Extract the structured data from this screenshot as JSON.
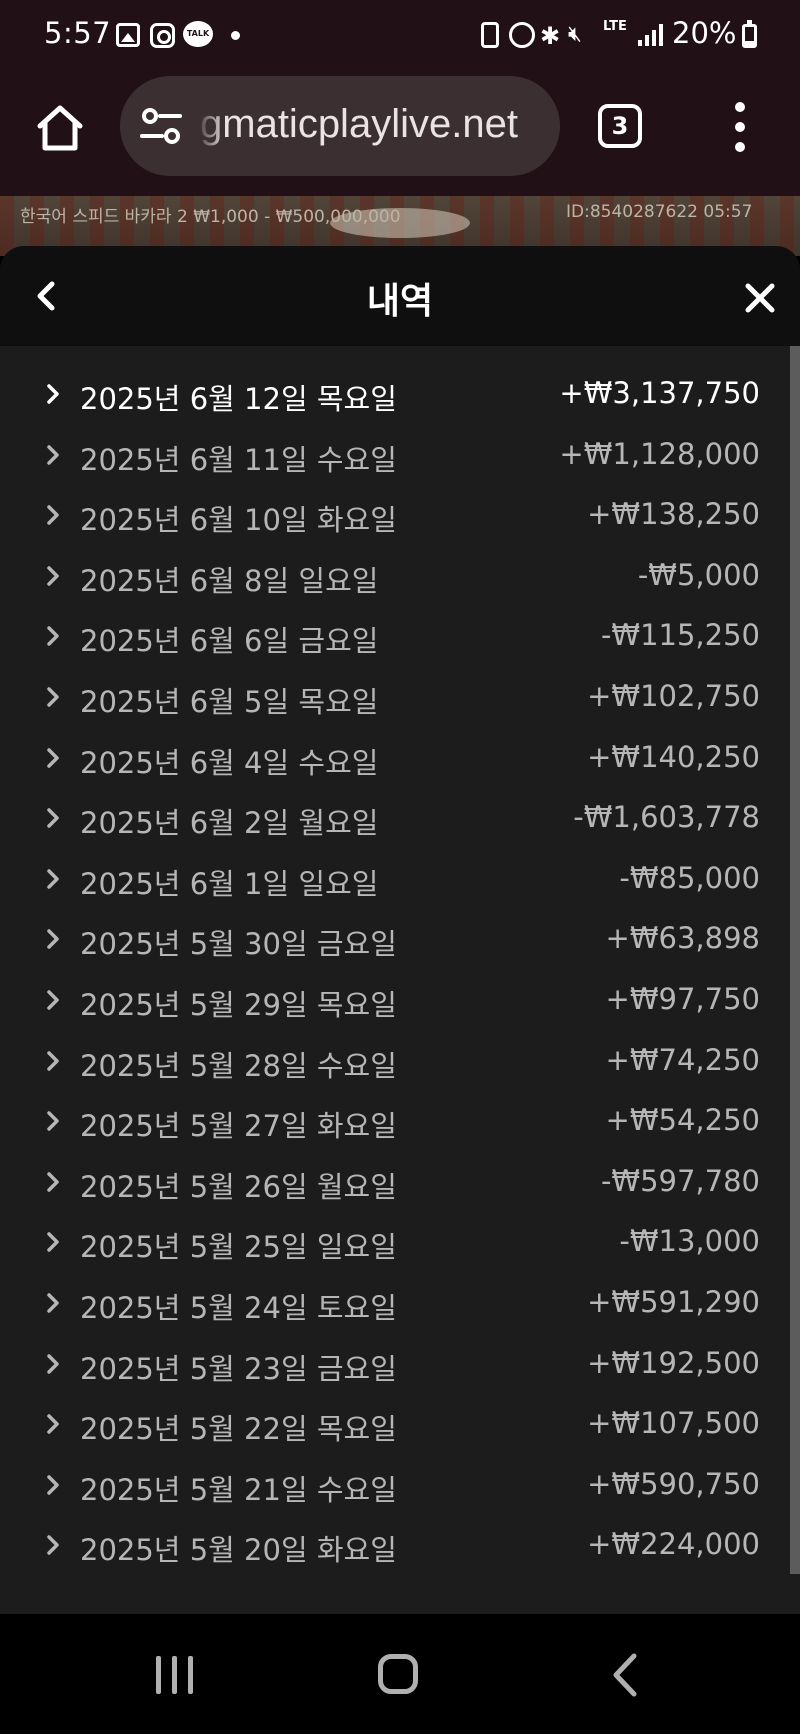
{
  "status_bar": {
    "time": "5:57",
    "notification_icons": [
      "gallery-icon",
      "instagram-icon",
      "kakaotalk-icon",
      "dot-icon"
    ],
    "kakaotalk_label": "TALK",
    "system_icons": [
      "battery-saver-icon",
      "alarm-icon",
      "bluetooth-icon",
      "mute-icon",
      "lte-icon",
      "signal-icon"
    ],
    "lte_label": "LTE",
    "battery_percent": "20%"
  },
  "browser": {
    "url": "gmaticplaylive.net",
    "tab_count": "3",
    "icons": [
      "home-icon",
      "site-settings-icon",
      "tabs-icon",
      "more-menu-icon"
    ]
  },
  "game": {
    "table_info": "한국어 스피드 바카라 2   ₩1,000 - ₩500,000,000",
    "id_info": "ID:8540287622   05:57"
  },
  "history": {
    "title": "내역",
    "rows": [
      {
        "date": "2025년 6월 12일 목요일",
        "amount": "+₩3,137,750"
      },
      {
        "date": "2025년 6월 11일 수요일",
        "amount": "+₩1,128,000"
      },
      {
        "date": "2025년 6월 10일 화요일",
        "amount": "+₩138,250"
      },
      {
        "date": "2025년 6월 8일 일요일",
        "amount": "-₩5,000"
      },
      {
        "date": "2025년 6월 6일 금요일",
        "amount": "-₩115,250"
      },
      {
        "date": "2025년 6월 5일 목요일",
        "amount": "+₩102,750"
      },
      {
        "date": "2025년 6월 4일 수요일",
        "amount": "+₩140,250"
      },
      {
        "date": "2025년 6월 2일 월요일",
        "amount": "-₩1,603,778"
      },
      {
        "date": "2025년 6월 1일 일요일",
        "amount": "-₩85,000"
      },
      {
        "date": "2025년 5월 30일 금요일",
        "amount": "+₩63,898"
      },
      {
        "date": "2025년 5월 29일 목요일",
        "amount": "+₩97,750"
      },
      {
        "date": "2025년 5월 28일 수요일",
        "amount": "+₩74,250"
      },
      {
        "date": "2025년 5월 27일 화요일",
        "amount": "+₩54,250"
      },
      {
        "date": "2025년 5월 26일 월요일",
        "amount": "-₩597,780"
      },
      {
        "date": "2025년 5월 25일 일요일",
        "amount": "-₩13,000"
      },
      {
        "date": "2025년 5월 24일 토요일",
        "amount": "+₩591,290"
      },
      {
        "date": "2025년 5월 23일 금요일",
        "amount": "+₩192,500"
      },
      {
        "date": "2025년 5월 22일 목요일",
        "amount": "+₩107,500"
      },
      {
        "date": "2025년 5월 21일 수요일",
        "amount": "+₩590,750"
      },
      {
        "date": "2025년 5월 20일 화요일",
        "amount": "+₩224,000"
      }
    ]
  },
  "navbar": {
    "icons": [
      "recent-apps-icon",
      "home-icon",
      "back-icon"
    ]
  }
}
